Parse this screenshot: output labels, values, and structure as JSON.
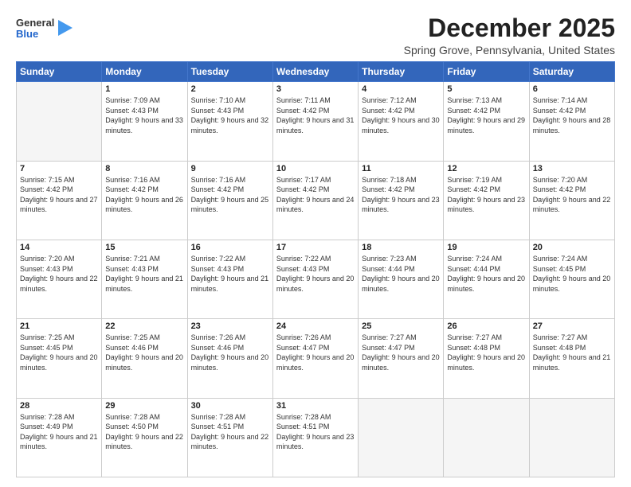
{
  "header": {
    "logo": {
      "general": "General",
      "blue": "Blue"
    },
    "title": "December 2025",
    "location": "Spring Grove, Pennsylvania, United States"
  },
  "calendar": {
    "days_of_week": [
      "Sunday",
      "Monday",
      "Tuesday",
      "Wednesday",
      "Thursday",
      "Friday",
      "Saturday"
    ],
    "weeks": [
      [
        {
          "day": "",
          "sunrise": "",
          "sunset": "",
          "daylight": "",
          "empty": true
        },
        {
          "day": "1",
          "sunrise": "Sunrise: 7:09 AM",
          "sunset": "Sunset: 4:43 PM",
          "daylight": "Daylight: 9 hours and 33 minutes."
        },
        {
          "day": "2",
          "sunrise": "Sunrise: 7:10 AM",
          "sunset": "Sunset: 4:43 PM",
          "daylight": "Daylight: 9 hours and 32 minutes."
        },
        {
          "day": "3",
          "sunrise": "Sunrise: 7:11 AM",
          "sunset": "Sunset: 4:42 PM",
          "daylight": "Daylight: 9 hours and 31 minutes."
        },
        {
          "day": "4",
          "sunrise": "Sunrise: 7:12 AM",
          "sunset": "Sunset: 4:42 PM",
          "daylight": "Daylight: 9 hours and 30 minutes."
        },
        {
          "day": "5",
          "sunrise": "Sunrise: 7:13 AM",
          "sunset": "Sunset: 4:42 PM",
          "daylight": "Daylight: 9 hours and 29 minutes."
        },
        {
          "day": "6",
          "sunrise": "Sunrise: 7:14 AM",
          "sunset": "Sunset: 4:42 PM",
          "daylight": "Daylight: 9 hours and 28 minutes."
        }
      ],
      [
        {
          "day": "7",
          "sunrise": "Sunrise: 7:15 AM",
          "sunset": "Sunset: 4:42 PM",
          "daylight": "Daylight: 9 hours and 27 minutes."
        },
        {
          "day": "8",
          "sunrise": "Sunrise: 7:16 AM",
          "sunset": "Sunset: 4:42 PM",
          "daylight": "Daylight: 9 hours and 26 minutes."
        },
        {
          "day": "9",
          "sunrise": "Sunrise: 7:16 AM",
          "sunset": "Sunset: 4:42 PM",
          "daylight": "Daylight: 9 hours and 25 minutes."
        },
        {
          "day": "10",
          "sunrise": "Sunrise: 7:17 AM",
          "sunset": "Sunset: 4:42 PM",
          "daylight": "Daylight: 9 hours and 24 minutes."
        },
        {
          "day": "11",
          "sunrise": "Sunrise: 7:18 AM",
          "sunset": "Sunset: 4:42 PM",
          "daylight": "Daylight: 9 hours and 23 minutes."
        },
        {
          "day": "12",
          "sunrise": "Sunrise: 7:19 AM",
          "sunset": "Sunset: 4:42 PM",
          "daylight": "Daylight: 9 hours and 23 minutes."
        },
        {
          "day": "13",
          "sunrise": "Sunrise: 7:20 AM",
          "sunset": "Sunset: 4:42 PM",
          "daylight": "Daylight: 9 hours and 22 minutes."
        }
      ],
      [
        {
          "day": "14",
          "sunrise": "Sunrise: 7:20 AM",
          "sunset": "Sunset: 4:43 PM",
          "daylight": "Daylight: 9 hours and 22 minutes."
        },
        {
          "day": "15",
          "sunrise": "Sunrise: 7:21 AM",
          "sunset": "Sunset: 4:43 PM",
          "daylight": "Daylight: 9 hours and 21 minutes."
        },
        {
          "day": "16",
          "sunrise": "Sunrise: 7:22 AM",
          "sunset": "Sunset: 4:43 PM",
          "daylight": "Daylight: 9 hours and 21 minutes."
        },
        {
          "day": "17",
          "sunrise": "Sunrise: 7:22 AM",
          "sunset": "Sunset: 4:43 PM",
          "daylight": "Daylight: 9 hours and 20 minutes."
        },
        {
          "day": "18",
          "sunrise": "Sunrise: 7:23 AM",
          "sunset": "Sunset: 4:44 PM",
          "daylight": "Daylight: 9 hours and 20 minutes."
        },
        {
          "day": "19",
          "sunrise": "Sunrise: 7:24 AM",
          "sunset": "Sunset: 4:44 PM",
          "daylight": "Daylight: 9 hours and 20 minutes."
        },
        {
          "day": "20",
          "sunrise": "Sunrise: 7:24 AM",
          "sunset": "Sunset: 4:45 PM",
          "daylight": "Daylight: 9 hours and 20 minutes."
        }
      ],
      [
        {
          "day": "21",
          "sunrise": "Sunrise: 7:25 AM",
          "sunset": "Sunset: 4:45 PM",
          "daylight": "Daylight: 9 hours and 20 minutes."
        },
        {
          "day": "22",
          "sunrise": "Sunrise: 7:25 AM",
          "sunset": "Sunset: 4:46 PM",
          "daylight": "Daylight: 9 hours and 20 minutes."
        },
        {
          "day": "23",
          "sunrise": "Sunrise: 7:26 AM",
          "sunset": "Sunset: 4:46 PM",
          "daylight": "Daylight: 9 hours and 20 minutes."
        },
        {
          "day": "24",
          "sunrise": "Sunrise: 7:26 AM",
          "sunset": "Sunset: 4:47 PM",
          "daylight": "Daylight: 9 hours and 20 minutes."
        },
        {
          "day": "25",
          "sunrise": "Sunrise: 7:27 AM",
          "sunset": "Sunset: 4:47 PM",
          "daylight": "Daylight: 9 hours and 20 minutes."
        },
        {
          "day": "26",
          "sunrise": "Sunrise: 7:27 AM",
          "sunset": "Sunset: 4:48 PM",
          "daylight": "Daylight: 9 hours and 20 minutes."
        },
        {
          "day": "27",
          "sunrise": "Sunrise: 7:27 AM",
          "sunset": "Sunset: 4:48 PM",
          "daylight": "Daylight: 9 hours and 21 minutes."
        }
      ],
      [
        {
          "day": "28",
          "sunrise": "Sunrise: 7:28 AM",
          "sunset": "Sunset: 4:49 PM",
          "daylight": "Daylight: 9 hours and 21 minutes."
        },
        {
          "day": "29",
          "sunrise": "Sunrise: 7:28 AM",
          "sunset": "Sunset: 4:50 PM",
          "daylight": "Daylight: 9 hours and 22 minutes."
        },
        {
          "day": "30",
          "sunrise": "Sunrise: 7:28 AM",
          "sunset": "Sunset: 4:51 PM",
          "daylight": "Daylight: 9 hours and 22 minutes."
        },
        {
          "day": "31",
          "sunrise": "Sunrise: 7:28 AM",
          "sunset": "Sunset: 4:51 PM",
          "daylight": "Daylight: 9 hours and 23 minutes."
        },
        {
          "day": "",
          "sunrise": "",
          "sunset": "",
          "daylight": "",
          "empty": true
        },
        {
          "day": "",
          "sunrise": "",
          "sunset": "",
          "daylight": "",
          "empty": true
        },
        {
          "day": "",
          "sunrise": "",
          "sunset": "",
          "daylight": "",
          "empty": true
        }
      ]
    ]
  }
}
